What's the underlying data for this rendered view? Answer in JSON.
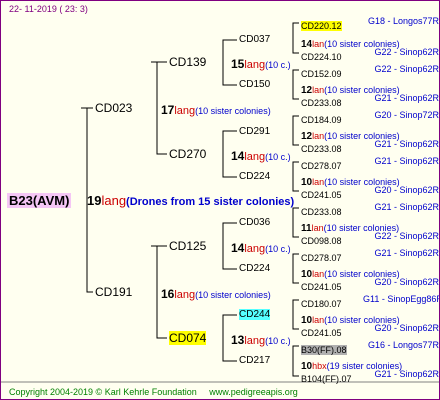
{
  "header": {
    "date": "22- 11-2019 ( 23:  3)"
  },
  "footer": {
    "copyright": "Copyright 2004-2019 © Karl Kehrle Foundation",
    "site": "www.pedigreeapis.org"
  },
  "root": {
    "name": "B23(AVM)",
    "count": "19",
    "lang": "lang",
    "note": "(Drones from 15 sister colonies)"
  },
  "g1": [
    {
      "name": "CD023",
      "count": "17",
      "lang": "lang",
      "note": "(10 sister colonies)"
    },
    {
      "name": "CD191",
      "count": "16",
      "lang": "lang",
      "note": "(10 sister colonies)"
    }
  ],
  "g2": [
    {
      "name": "CD139",
      "count": "15",
      "lang": "lang",
      "note": "(10 c.)"
    },
    {
      "name": "CD270",
      "count": "14",
      "lang": "lang",
      "note": "(10 c.)"
    },
    {
      "name": "CD125",
      "count": "14",
      "lang": "lang",
      "note": "(10 c.)"
    },
    {
      "name": "CD074",
      "count": "13",
      "lang": "lang",
      "note": "(10 c.)"
    }
  ],
  "g3": [
    {
      "name": "CD037"
    },
    {
      "name": "CD150"
    },
    {
      "name": "CD291"
    },
    {
      "name": "CD224"
    },
    {
      "name": "CD036"
    },
    {
      "name": "CD224"
    },
    {
      "name": "CD244"
    },
    {
      "name": "CD217"
    }
  ],
  "g4": [
    {
      "name": "CD220.12",
      "tag": "G18 - Longos77R"
    },
    {
      "count": "14",
      "lang": "lan",
      "note": "(10 sister colonies)"
    },
    {
      "name": "CD224.10",
      "tag": "G22 - Sinop62R"
    },
    {
      "name": "CD152.09",
      "tag": "G22 - Sinop62R"
    },
    {
      "count": "12",
      "lang": "lan",
      "note": "(10 sister colonies)"
    },
    {
      "name": "CD233.08",
      "tag": "G21 - Sinop62R"
    },
    {
      "name": "CD184.09",
      "tag": "G20 - Sinop72R"
    },
    {
      "count": "12",
      "lang": "lan",
      "note": "(10 sister colonies)"
    },
    {
      "name": "CD233.08",
      "tag": "G21 - Sinop62R"
    },
    {
      "name": "CD278.07",
      "tag": "G21 - Sinop62R"
    },
    {
      "count": "10",
      "lang": "lan",
      "note": "(10 sister colonies)"
    },
    {
      "name": "CD241.05",
      "tag": "G20 - Sinop62R"
    },
    {
      "name": "CD233.08",
      "tag": "G21 - Sinop62R"
    },
    {
      "count": "11",
      "lang": "lan",
      "note": "(10 sister colonies)"
    },
    {
      "name": "CD098.08",
      "tag": "G22 - Sinop62R"
    },
    {
      "name": "CD278.07",
      "tag": "G21 - Sinop62R"
    },
    {
      "count": "10",
      "lang": "lan",
      "note": "(10 sister colonies)"
    },
    {
      "name": "CD241.05",
      "tag": "G20 - Sinop62R"
    },
    {
      "name": "CD180.07",
      "tag": "G11 - SinopEgg86R"
    },
    {
      "count": "10",
      "lang": "lan",
      "note": "(10 sister colonies)"
    },
    {
      "name": "CD241.05",
      "tag": "G20 - Sinop62R"
    },
    {
      "name": "B30(FF).08",
      "tag": "G16 - Longos77R"
    },
    {
      "count": "10",
      "lang": "hbx",
      "note": "(19 sister colonies)"
    },
    {
      "name": "B104(FF).07",
      "tag": "G21 - Sinop62R"
    }
  ],
  "colors": {
    "border": "#800080",
    "line": "#000000",
    "lang": "#cc0000",
    "note": "#0000cc",
    "rootHighlight": "#f5c6f5",
    "yellow": "#ffff00",
    "cyan": "#55ffff"
  }
}
